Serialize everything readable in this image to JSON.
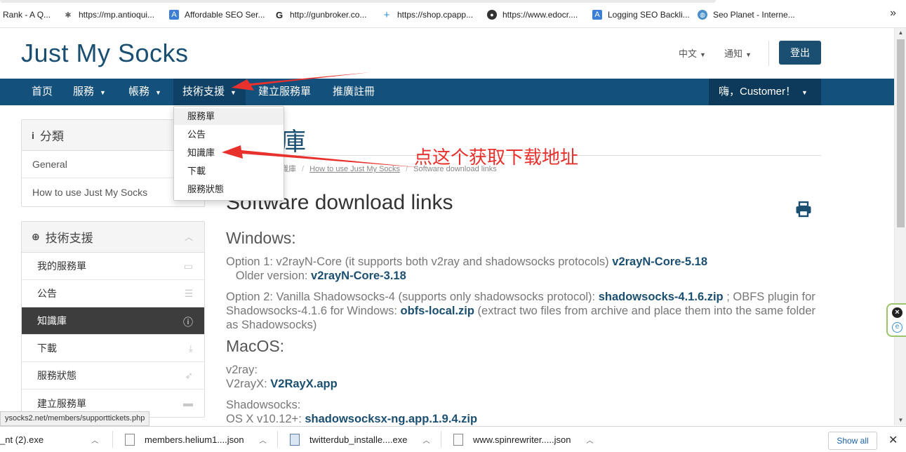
{
  "bookmarks": [
    {
      "label": "Rank - A Q...",
      "icon": "none"
    },
    {
      "label": "https://mp.antioqui...",
      "icon": "bug-icon"
    },
    {
      "label": "Affordable SEO Ser...",
      "icon": "a-logo-icon"
    },
    {
      "label": "http://gunbroker.co...",
      "icon": "google-g-icon"
    },
    {
      "label": "https://shop.cpapp...",
      "icon": "plus-icon"
    },
    {
      "label": "https://www.edocr....",
      "icon": "circle-icon"
    },
    {
      "label": "Logging SEO Backli...",
      "icon": "a-logo-icon"
    },
    {
      "label": "Seo Planet - Interne...",
      "icon": "globe-icon"
    }
  ],
  "bookmarks_more": "»",
  "header": {
    "logo": "Just My Socks",
    "language": "中文",
    "notifications": "通知",
    "login": "登出"
  },
  "nav": {
    "home": "首页",
    "services": "服務",
    "billing": "帳務",
    "support": "技術支援",
    "open_ticket": "建立服務單",
    "affiliate": "推廣註冊",
    "user": "嗨，Customer！"
  },
  "dropdown": [
    "服務單",
    "公告",
    "知識庫",
    "下載",
    "服務狀態"
  ],
  "sidebar": {
    "categories_title": "分類",
    "categories": [
      "General",
      "How to use Just My Socks"
    ],
    "support_title": "技術支援",
    "support_items": [
      {
        "label": "我的服務單",
        "icon": "ticket-icon"
      },
      {
        "label": "公告",
        "icon": "list-icon"
      },
      {
        "label": "知識庫",
        "icon": "info-icon"
      },
      {
        "label": "下載",
        "icon": "download-icon"
      },
      {
        "label": "服務狀態",
        "icon": "rocket-icon"
      },
      {
        "label": "建立服務單",
        "icon": "comments-icon"
      }
    ]
  },
  "main": {
    "page_title": "知識庫",
    "title_visible": "庫",
    "breadcrumb": [
      "知識庫",
      "How to use Just My Socks",
      "Software download links"
    ],
    "crumb_visible": "識庫",
    "article_title": "Software download links",
    "windows_heading": "Windows:",
    "win_opt1_text": "Option 1: v2rayN-Core (it supports both v2ray and shadowsocks protocols) ",
    "win_opt1_link": "v2rayN-Core-5.18",
    "win_opt1_older": "   Older version: ",
    "win_opt1_older_link": "v2rayN-Core-3.18",
    "win_opt2_text": "Option 2: Vanilla Shadowsocks-4 (supports only shadowsocks protocol): ",
    "win_opt2_link": "shadowsocks-4.1.6.zip",
    "win_opt2_mid": " ; OBFS plugin for Shadowsocks-4.1.6 for Windows: ",
    "win_opt2_link2": "obfs-local.zip",
    "win_opt2_end": " (extract two files from archive and place them into the same folder as Shadowsocks)",
    "mac_heading": "MacOS:",
    "mac_v2ray_label": "v2ray:",
    "mac_v2rayx_text": "V2rayX: ",
    "mac_v2rayx_link": "V2RayX.app",
    "mac_ss_label": "Shadowsocks:",
    "mac_ss_text": "OS X v10.12+: ",
    "mac_ss_link": "shadowsocksx-ng.app.1.9.4.zip"
  },
  "annotation": "点这个获取下载地址",
  "status_url": "ysocks2.net/members/supporttickets.php",
  "downloads": [
    {
      "name": "_nt (2).exe",
      "type": "exe"
    },
    {
      "name": "members.helium1....json",
      "type": "file"
    },
    {
      "name": "twitterdub_installe....exe",
      "type": "exe"
    },
    {
      "name": "www.spinrewriter.....json",
      "type": "file"
    }
  ],
  "show_all": "Show all",
  "colors": {
    "brand": "#1b4f72",
    "navbar": "#13507b",
    "annotation": "#e8302d",
    "active_sidebar": "#3d3d3d"
  }
}
